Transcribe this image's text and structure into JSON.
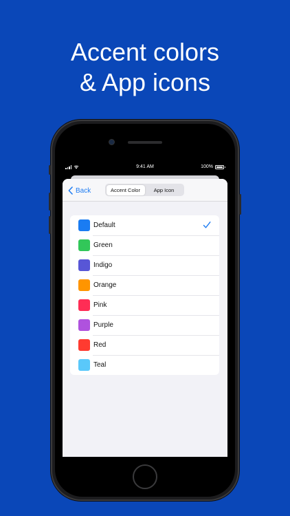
{
  "headline": {
    "line1": "Accent colors",
    "line2": "& App icons"
  },
  "status_bar": {
    "time": "9:41 AM",
    "battery": "100%"
  },
  "nav": {
    "back_label": "Back",
    "segments": [
      {
        "label": "Accent Color",
        "selected": true
      },
      {
        "label": "App Icon",
        "selected": false
      }
    ]
  },
  "colors": [
    {
      "name": "Default",
      "hex": "#1a7cf2",
      "selected": true
    },
    {
      "name": "Green",
      "hex": "#32c759"
    },
    {
      "name": "Indigo",
      "hex": "#5856d6"
    },
    {
      "name": "Orange",
      "hex": "#ff9500"
    },
    {
      "name": "Pink",
      "hex": "#ff2d55"
    },
    {
      "name": "Purple",
      "hex": "#af52de"
    },
    {
      "name": "Red",
      "hex": "#ff3b30"
    },
    {
      "name": "Teal",
      "hex": "#5ac8fa"
    }
  ],
  "theme": {
    "background": "#0a47b8",
    "accent": "#1e7cf2"
  },
  "icons": {
    "back": "chevron-left-icon",
    "selected": "checkmark-icon"
  }
}
